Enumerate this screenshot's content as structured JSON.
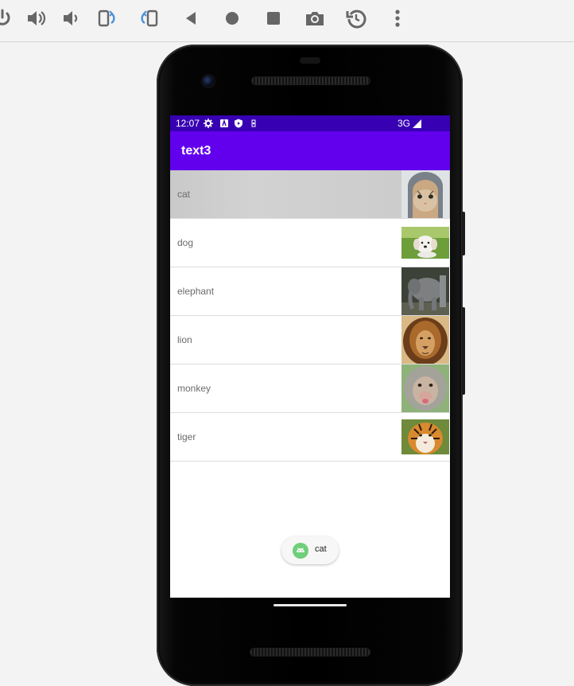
{
  "toolbar": {
    "icons": [
      "power-icon",
      "volume-up-icon",
      "volume-down-icon",
      "rotate-left-icon",
      "rotate-right-icon",
      "back-icon",
      "home-icon",
      "overview-icon",
      "screenshot-icon",
      "rewind-icon",
      "more-icon"
    ]
  },
  "statusbar": {
    "time": "12:07",
    "network": "3G"
  },
  "appbar": {
    "title": "text3"
  },
  "list": {
    "items": [
      {
        "label": "cat",
        "pressed": true
      },
      {
        "label": "dog"
      },
      {
        "label": "elephant"
      },
      {
        "label": "lion"
      },
      {
        "label": "monkey"
      },
      {
        "label": "tiger"
      }
    ]
  },
  "toast": {
    "text": "cat"
  },
  "colors": {
    "status_bar": "#3700b3",
    "app_bar": "#6200ee",
    "pressed_row": "#cacaca",
    "toast_icon": "#6fcf7a"
  }
}
